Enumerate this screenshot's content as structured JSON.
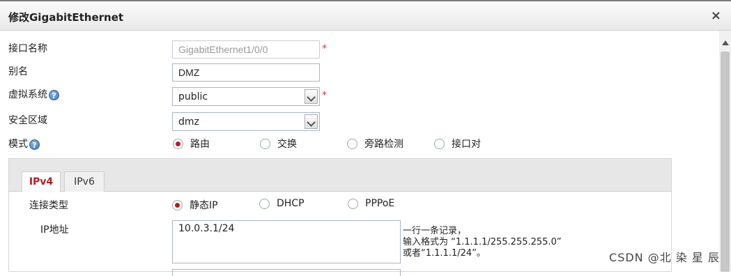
{
  "dialog": {
    "title": "修改GigabitEthernet",
    "close_glyph": "×"
  },
  "form": {
    "interface_name": {
      "label": "接口名称",
      "value": "GigabitEthernet1/0/0",
      "required_mark": "*"
    },
    "alias": {
      "label": "别名",
      "value": "DMZ"
    },
    "virtual_system": {
      "label": "虚拟系统",
      "help": "?",
      "value": "public",
      "required_mark": "*"
    },
    "security_zone": {
      "label": "安全区域",
      "value": "dmz"
    },
    "mode": {
      "label": "模式",
      "help": "?",
      "options": [
        "路由",
        "交换",
        "旁路检测",
        "接口对"
      ],
      "selected": "路由"
    }
  },
  "tabs": [
    {
      "label": "IPv4",
      "active": true
    },
    {
      "label": "IPv6",
      "active": false
    }
  ],
  "ipv4": {
    "connection_type": {
      "label": "连接类型",
      "options": [
        "静态IP",
        "DHCP",
        "PPPoE"
      ],
      "selected": "静态IP"
    },
    "ip_address": {
      "label": "IP地址",
      "value": "10.0.3.1/24",
      "hint": [
        "一行一条记录，",
        "输入格式为 “1.1.1.1/255.255.255.0”",
        "或者“1.1.1.1/24”。"
      ]
    }
  },
  "watermark": "CSDN @北 染 星 辰",
  "colors": {
    "accent": "#b41e1e",
    "required": "#dd3333",
    "help": "#3f73b8"
  }
}
